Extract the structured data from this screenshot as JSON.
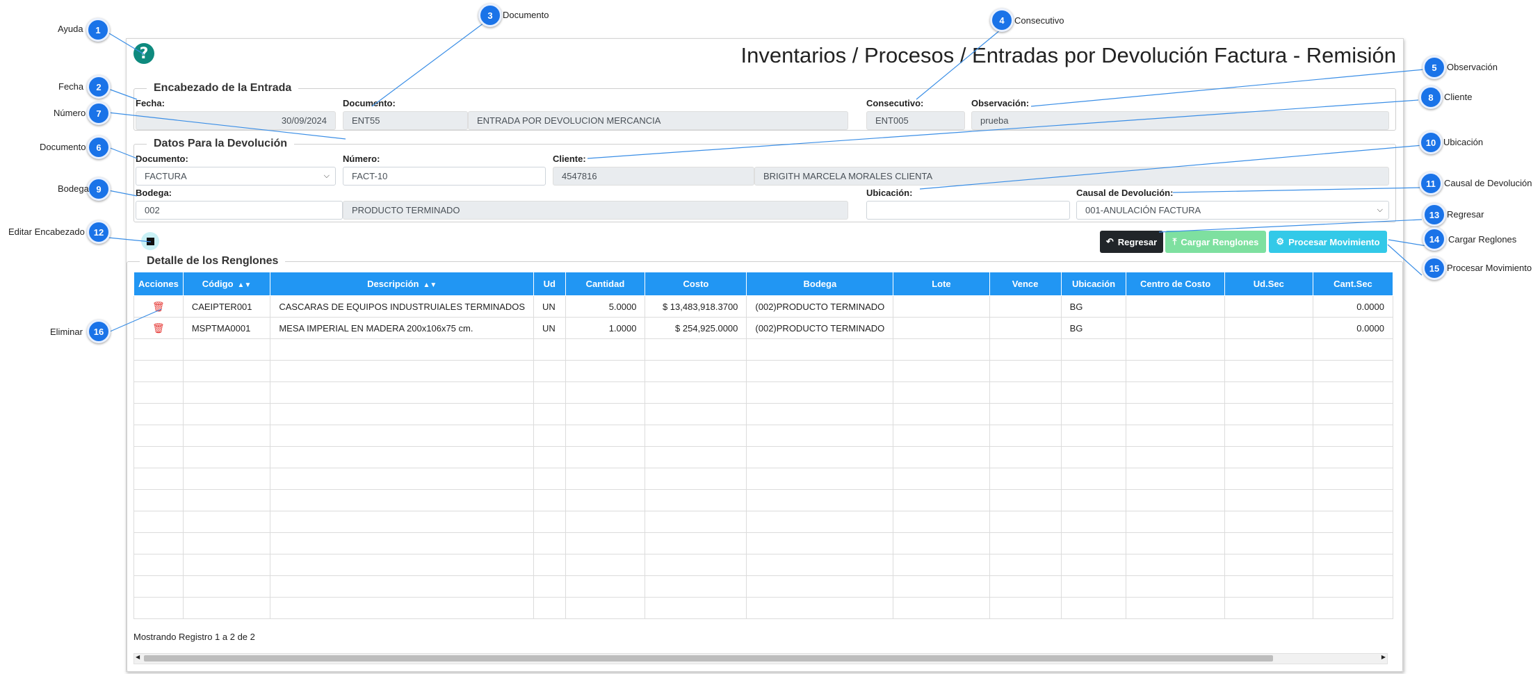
{
  "page": {
    "title": "Inventarios / Procesos / Entradas por Devolución Factura - Remisión"
  },
  "encabezado": {
    "legend": "Encabezado de la Entrada",
    "fecha_label": "Fecha:",
    "fecha_value": "30/09/2024",
    "documento_label": "Documento:",
    "documento_code": "ENT55",
    "documento_desc": "ENTRADA POR DEVOLUCION MERCANCIA",
    "consecutivo_label": "Consecutivo:",
    "consecutivo_value": "ENT005",
    "observacion_label": "Observación:",
    "observacion_value": "prueba"
  },
  "devolucion": {
    "legend": "Datos Para la Devolución",
    "documento_label": "Documento:",
    "documento_selected": "FACTURA",
    "numero_label": "Número:",
    "numero_value": "FACT-10",
    "cliente_label": "Cliente:",
    "cliente_code": "4547816",
    "cliente_name": "BRIGITH MARCELA MORALES CLIENTA",
    "bodega_label": "Bodega:",
    "bodega_code": "002",
    "bodega_name": "PRODUCTO TERMINADO",
    "ubicacion_label": "Ubicación:",
    "ubicacion_value": "",
    "causal_label": "Causal de Devolución:",
    "causal_selected": "001-ANULACIÓN FACTURA"
  },
  "actions": {
    "regresar": "Regresar",
    "cargar": "Cargar Renglones",
    "procesar": "Procesar Movimiento"
  },
  "detalle": {
    "legend": "Detalle de los Renglones",
    "columns": [
      "Acciones",
      "Código",
      "Descripción",
      "Ud",
      "Cantidad",
      "Costo",
      "Bodega",
      "Lote",
      "Vence",
      "Ubicación",
      "Centro de Costo",
      "Ud.Sec",
      "Cant.Sec"
    ],
    "rows": [
      {
        "codigo": "CAEIPTER001",
        "descripcion": "CASCARAS DE EQUIPOS INDUSTRUIALES TERMINADOS",
        "ud": "UN",
        "cantidad": "5.0000",
        "costo": "$ 13,483,918.3700",
        "bodega": "(002)PRODUCTO TERMINADO",
        "lote": "",
        "vence": "",
        "ubicacion": "BG",
        "centro": "",
        "udsec": "",
        "cantsec": "0.0000"
      },
      {
        "codigo": "MSPTMA0001",
        "descripcion": "MESA IMPERIAL EN MADERA 200x106x75 cm.",
        "ud": "UN",
        "cantidad": "1.0000",
        "costo": "$ 254,925.0000",
        "bodega": "(002)PRODUCTO TERMINADO",
        "lote": "",
        "vence": "",
        "ubicacion": "BG",
        "centro": "",
        "udsec": "",
        "cantsec": "0.0000"
      }
    ],
    "footer": "Mostrando Registro 1 a 2 de 2"
  },
  "callouts": [
    {
      "n": "1",
      "label": "Ayuda"
    },
    {
      "n": "2",
      "label": "Fecha"
    },
    {
      "n": "3",
      "label": "Documento"
    },
    {
      "n": "4",
      "label": "Consecutivo"
    },
    {
      "n": "5",
      "label": "Observación"
    },
    {
      "n": "6",
      "label": "Documento"
    },
    {
      "n": "7",
      "label": "Número"
    },
    {
      "n": "8",
      "label": "Cliente"
    },
    {
      "n": "9",
      "label": "Bodega"
    },
    {
      "n": "10",
      "label": "Ubicación"
    },
    {
      "n": "11",
      "label": "Causal de Devolución"
    },
    {
      "n": "12",
      "label": "Editar Encabezado"
    },
    {
      "n": "13",
      "label": "Regresar"
    },
    {
      "n": "14",
      "label": "Cargar Reglones"
    },
    {
      "n": "15",
      "label": "Procesar Movimiento"
    },
    {
      "n": "16",
      "label": "Eliminar"
    }
  ],
  "colors": {
    "header_blue": "#2196f3",
    "badge_blue": "#1a73e8",
    "help_teal": "#0e8a7e",
    "regresar_bg": "#212529",
    "cargar_bg": "#7ee0a0",
    "procesar_bg": "#33c9e8",
    "trash_red": "#e53935"
  },
  "icons": {
    "help": "question-circle-icon",
    "edit": "pencil-square-icon",
    "back": "reply-arrow-icon",
    "upload": "upload-icon",
    "cogs": "cogs-icon",
    "trash": "trash-icon",
    "sort": "sort-icon"
  }
}
